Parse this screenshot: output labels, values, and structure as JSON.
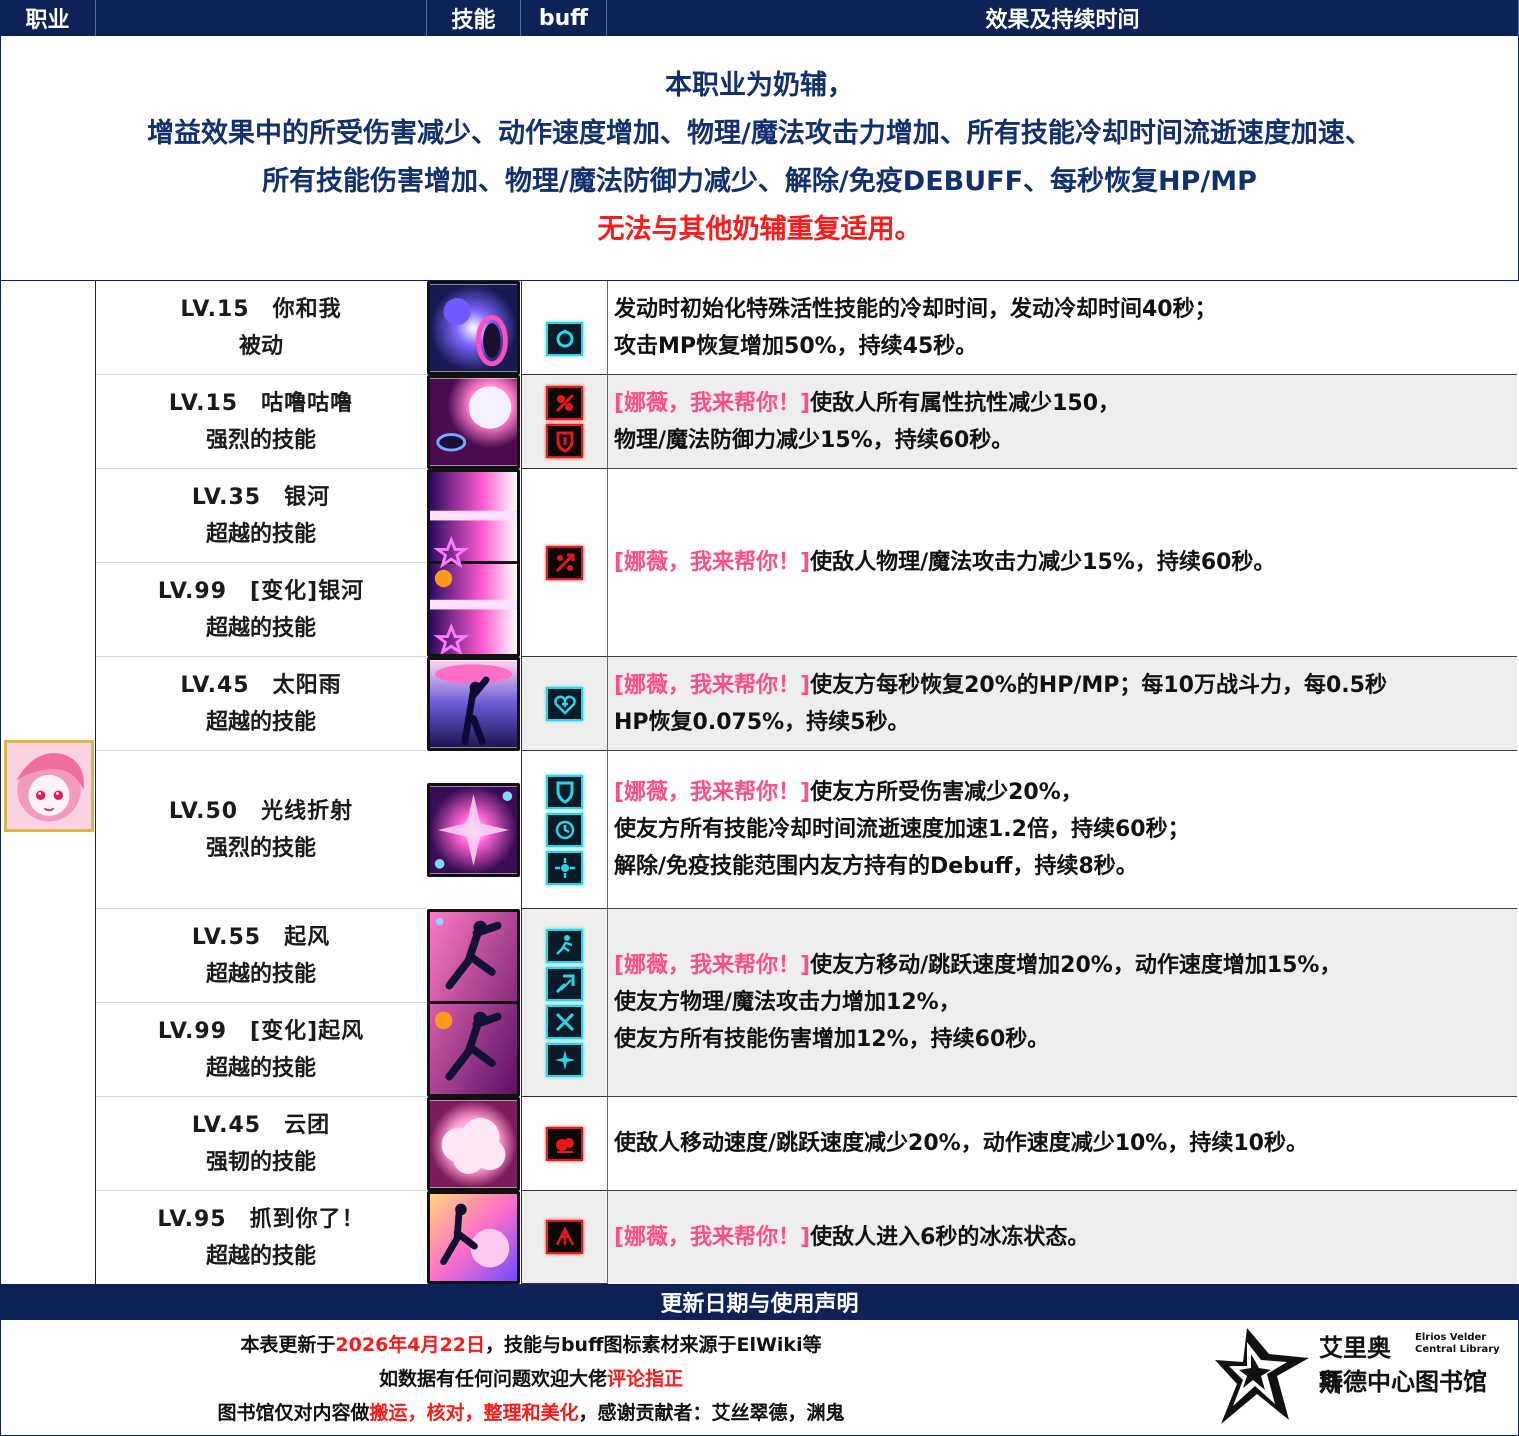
{
  "header": {
    "col_class": "职业",
    "col_skill": "技能",
    "col_buff": "buff",
    "col_effect": "效果及持续时间"
  },
  "intro": {
    "line1": "本职业为奶辅，",
    "line2": "增益效果中的所受伤害减少、动作速度增加、物理/魔法攻击力增加、所有技能冷却时间流逝速度加速、",
    "line3": "所有技能伤害增加、物理/魔法防御力减少、解除/免疫DEBUFF、每秒恢复HP/MP",
    "warning": "无法与其他奶辅重复适用。"
  },
  "skills": [
    {
      "lv": "LV.15　你和我",
      "type": "被动"
    },
    {
      "lv": "LV.15　咕噜咕噜",
      "type": "强烈的技能"
    },
    {
      "lv": "LV.35　银河",
      "type": "超越的技能"
    },
    {
      "lv": "LV.99　[变化]银河",
      "type": "超越的技能"
    },
    {
      "lv": "LV.45　太阳雨",
      "type": "超越的技能"
    },
    {
      "lv": "LV.50　光线折射",
      "type": "强烈的技能"
    },
    {
      "lv": "LV.55　起风",
      "type": "超越的技能"
    },
    {
      "lv": "LV.99　[变化]起风",
      "type": "超越的技能"
    },
    {
      "lv": "LV.45　云团",
      "type": "强韧的技能"
    },
    {
      "lv": "LV.95　抓到你了！",
      "type": "超越的技能"
    }
  ],
  "effects": {
    "e1": {
      "l1": "发动时初始化特殊活性技能的冷却时间，发动冷却时间40秒；",
      "l2": "攻击MP恢复增加50%，持续45秒。"
    },
    "e2": {
      "tag": "[娜薇，我来帮你！]",
      "l1": "使敌人所有属性抗性减少150，",
      "l2": "物理/魔法防御力减少15%，持续60秒。"
    },
    "e3": {
      "tag": "[娜薇，我来帮你！]",
      "l1": "使敌人物理/魔法攻击力减少15%，持续60秒。"
    },
    "e4": {
      "tag": "[娜薇，我来帮你！]",
      "l1": "使友方每秒恢复20%的HP/MP；每10万战斗力，每0.5秒",
      "l2": "HP恢复0.075%，持续5秒。"
    },
    "e5": {
      "tag": "[娜薇，我来帮你！]",
      "l1": "使友方所受伤害减少20%，",
      "l2": "使友方所有技能冷却时间流逝速度加速1.2倍，持续60秒；",
      "l3": "解除/免疫技能范围内友方持有的Debuff，持续8秒。"
    },
    "e6": {
      "tag": "[娜薇，我来帮你！]",
      "l1": "使友方移动/跳跃速度增加20%，动作速度增加15%，",
      "l2": "使友方物理/魔法攻击力增加12%，",
      "l3": "使友方所有技能伤害增加12%，持续60秒。"
    },
    "e7": {
      "l1": "使敌人移动速度/跳跃速度减少20%，动作速度减少10%，持续10秒。"
    },
    "e8": {
      "tag": "[娜薇，我来帮你！]",
      "l1": "使敌人进入6秒的冰冻状态。"
    }
  },
  "footer": {
    "title": "更新日期与使用声明",
    "l1_a": "本表更新于",
    "l1_date": "2026年4月22日",
    "l1_b": "，技能与buff图标素材来源于ElWiki等",
    "l2_a": "如数据有任何问题欢迎大佬",
    "l2_b": "评论指正",
    "l3_a": "图书馆仅对内容做",
    "l3_b": "搬运，核对，整理和美化",
    "l3_c": "，感谢贡献者：艾丝翠德，渊鬼"
  },
  "logo": {
    "cn_line1": "艾里奥斯",
    "en_line1": "Elrios Velder",
    "en_line2": "Central Library",
    "cn_line2": "拜德中心图书馆"
  },
  "colors": {
    "navy": "#0f2257",
    "text_blue": "#12306e",
    "red": "#ff1a1a",
    "pink": "#ff4f86",
    "buff_cyan": "#26d6e6",
    "debuff_red": "#e31a1a",
    "row_grey": "#eeeeee"
  }
}
